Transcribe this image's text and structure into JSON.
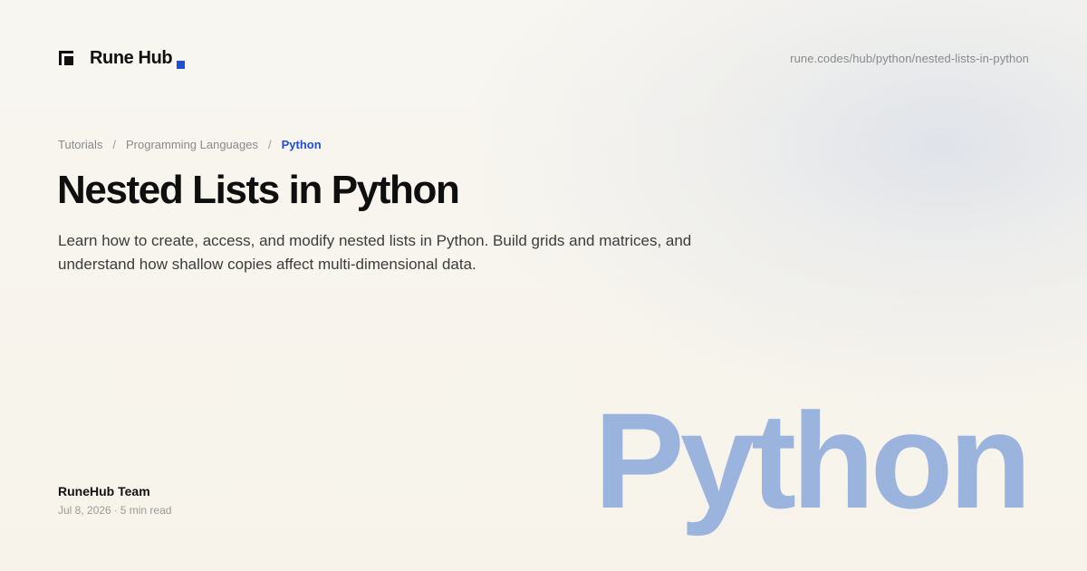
{
  "brand": {
    "name": "Rune Hub",
    "accent_color": "#1f4fd6",
    "icon": "rune-hub-logo-icon"
  },
  "url": "rune.codes/hub/python/nested-lists-in-python",
  "breadcrumb": {
    "items": [
      "Tutorials",
      "Programming Languages",
      "Python"
    ],
    "separator": "/"
  },
  "article": {
    "title": "Nested Lists in Python",
    "description": "Learn how to create, access, and modify nested lists in Python. Build grids and matrices, and understand how shallow copies affect multi-dimensional data.",
    "author": "RuneHub Team",
    "date": "Jul 8, 2026",
    "meta_separator": "·",
    "read_time": "5 min read"
  },
  "watermark": {
    "text": "Python",
    "color": "#9bb4de"
  }
}
